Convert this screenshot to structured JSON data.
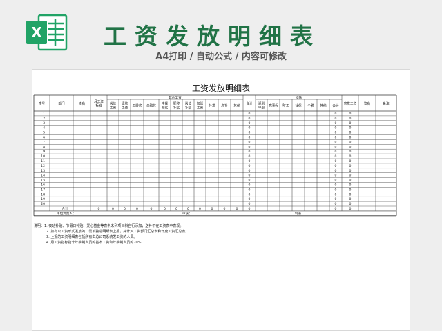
{
  "header": {
    "title": "工资发放明细表",
    "subtitle": "A4打印 / 自动公式 / 内容可修改",
    "logo_icon": "excel-icon",
    "logo_letter": "X",
    "accent_color": "#217346"
  },
  "sheet": {
    "title": "工资发放明细表",
    "group_other": "其他工资",
    "group_deduct": "扣除",
    "columns": [
      "序号",
      "部门",
      "姓名",
      "月工资标准",
      "岗位工资",
      "绩效工资",
      "工龄奖",
      "全勤奖",
      "中餐补贴",
      "职称补贴",
      "岗位补贴",
      "加班工资",
      "补发",
      "房补",
      "其他",
      "合计",
      "迟到早退",
      "病事假",
      "旷工",
      "社保",
      "个税",
      "其他",
      "合计",
      "实发工资",
      "签名",
      "备注"
    ],
    "rows": [
      {
        "no": "1",
        "sum": "0",
        "net": "0",
        "ded": "0"
      },
      {
        "no": "2",
        "sum": "0",
        "net": "0",
        "ded": "0"
      },
      {
        "no": "3",
        "sum": "0",
        "net": "0",
        "ded": "0"
      },
      {
        "no": "4",
        "sum": "0",
        "net": "0",
        "ded": "0"
      },
      {
        "no": "5",
        "sum": "0",
        "net": "0",
        "ded": "0"
      },
      {
        "no": "6",
        "sum": "0",
        "net": "0",
        "ded": "0"
      },
      {
        "no": "7",
        "sum": "0",
        "net": "0",
        "ded": "0"
      },
      {
        "no": "8",
        "sum": "0",
        "net": "0",
        "ded": "0"
      },
      {
        "no": "9",
        "sum": "0",
        "net": "0",
        "ded": "0"
      },
      {
        "no": "10",
        "sum": "0",
        "net": "0",
        "ded": "0"
      },
      {
        "no": "11",
        "sum": "0",
        "net": "0",
        "ded": "0"
      },
      {
        "no": "12",
        "sum": "0",
        "net": "0",
        "ded": "0"
      },
      {
        "no": "13",
        "sum": "0",
        "net": "0",
        "ded": "0"
      },
      {
        "no": "14",
        "sum": "0",
        "net": "0",
        "ded": "0"
      },
      {
        "no": "15",
        "sum": "0",
        "net": "0",
        "ded": "0"
      },
      {
        "no": "16",
        "sum": "0",
        "net": "0",
        "ded": "0"
      },
      {
        "no": "17",
        "sum": "0",
        "net": "0",
        "ded": "0"
      },
      {
        "no": "18",
        "sum": "0",
        "net": "0",
        "ded": "0"
      },
      {
        "no": "19",
        "sum": "0",
        "net": "0",
        "ded": "0"
      },
      {
        "no": "20",
        "sum": "0",
        "net": "0",
        "ded": "0"
      }
    ],
    "total": {
      "label": "合计",
      "values": [
        "0",
        "0",
        "0",
        "0",
        "0",
        "0",
        "0",
        "0",
        "0",
        "0",
        "0",
        "0"
      ],
      "sum": "0",
      "net": "0",
      "ded": "0"
    },
    "footer": {
      "owner": "单位负责人：",
      "review": "审核：",
      "maker": "制表："
    },
    "notes": [
      "说明：1. 夜班补贴、节假日补贴、爱心基金等表中未列项目科自行添加，送补不在工资表中表现。",
      "2. 如有以工资形式发放的，需单独造明细表上报，并计入工资部门汇总表和年度工资汇总表。",
      "3. 上报的工资明细表包括所有由总公司系统发工资的人员。",
      "4. 月工资指标指非年薪制人员的基本工资和年薪制人员的70%"
    ]
  }
}
